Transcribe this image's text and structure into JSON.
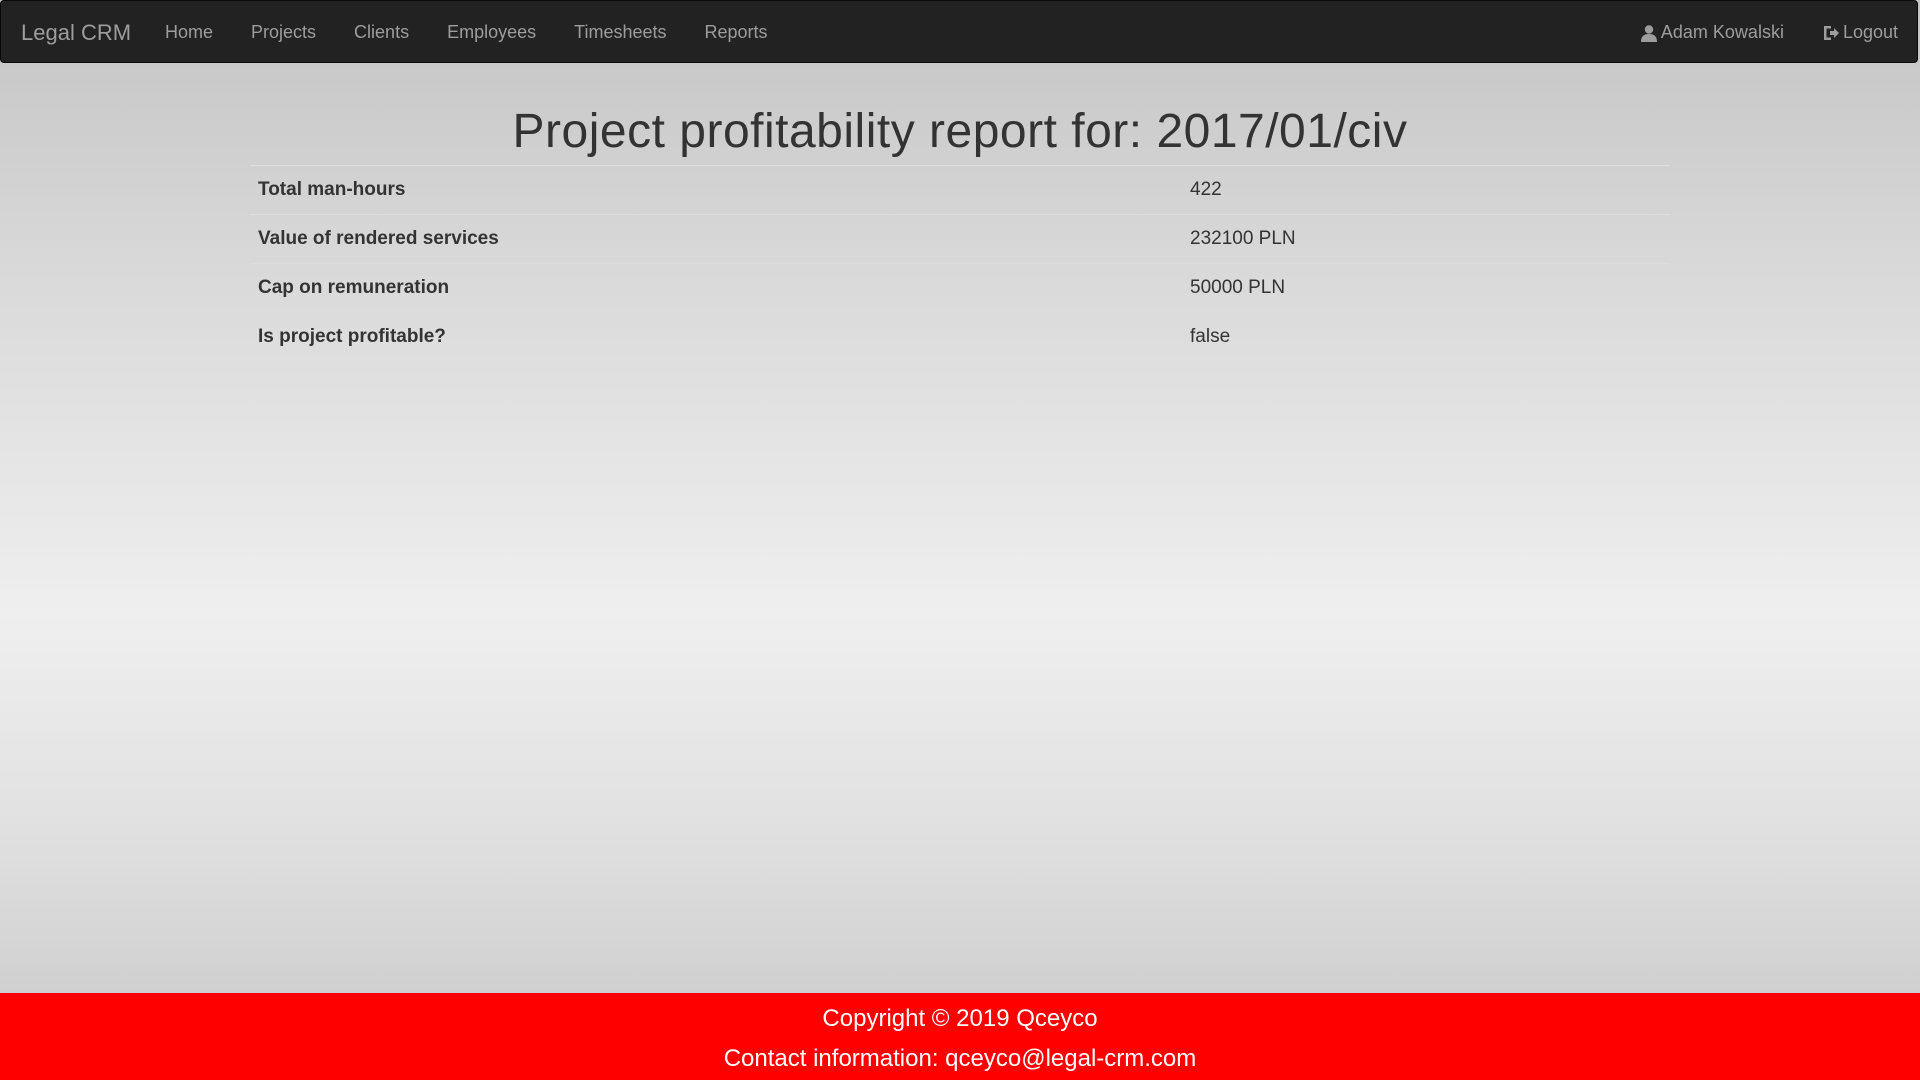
{
  "navbar": {
    "brand": "Legal CRM",
    "items": [
      {
        "label": "Home"
      },
      {
        "label": "Projects"
      },
      {
        "label": "Clients"
      },
      {
        "label": "Employees"
      },
      {
        "label": "Timesheets"
      },
      {
        "label": "Reports"
      }
    ],
    "user": {
      "name": "Adam Kowalski",
      "icon": "user-icon"
    },
    "logout": {
      "label": "Logout",
      "icon": "logout-icon"
    }
  },
  "report": {
    "title": "Project profitability report for: 2017/01/civ",
    "rows": [
      {
        "label": "Total man-hours",
        "value": "422"
      },
      {
        "label": "Value of rendered services",
        "value": "232100 PLN"
      },
      {
        "label": "Cap on remuneration",
        "value": "50000 PLN"
      },
      {
        "label": "Is project profitable?",
        "value": "false"
      }
    ]
  },
  "footer": {
    "copyright": "Copyright © 2019 Qceyco",
    "contact": "Contact information: qceyco@legal-crm.com"
  },
  "colors": {
    "navbar_bg": "#222222",
    "nav_text": "#9d9d9d",
    "footer_bg": "#ff0000",
    "text": "#333333"
  }
}
